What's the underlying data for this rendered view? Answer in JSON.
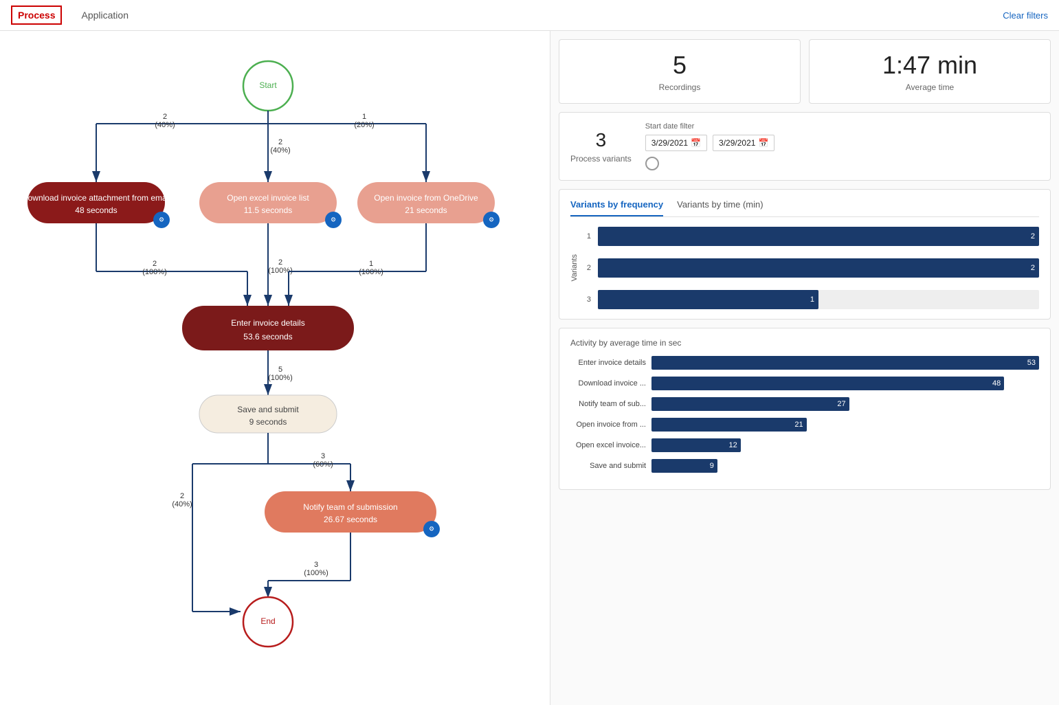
{
  "nav": {
    "tabs": [
      {
        "id": "process",
        "label": "Process",
        "active": true
      },
      {
        "id": "application",
        "label": "Application",
        "active": false
      }
    ],
    "clear_filters": "Clear filters"
  },
  "stats": {
    "recordings": {
      "value": "5",
      "label": "Recordings"
    },
    "average_time": {
      "value": "1:47 min",
      "label": "Average time"
    },
    "process_variants": {
      "value": "3",
      "label": "Process variants"
    },
    "start_date_filter": {
      "label": "Start date filter",
      "from": "3/29/2021",
      "to": "3/29/2021"
    }
  },
  "variants_chart": {
    "tab_frequency": "Variants by frequency",
    "tab_time": "Variants by time (min)",
    "y_label": "Variants",
    "bars": [
      {
        "label": "1",
        "value": 2,
        "pct": 100
      },
      {
        "label": "2",
        "value": 2,
        "pct": 100
      },
      {
        "label": "3",
        "value": 1,
        "pct": 50
      }
    ]
  },
  "activity_chart": {
    "title": "Activity by average time in sec",
    "bars": [
      {
        "label": "Enter invoice details",
        "value": 53,
        "pct": 100
      },
      {
        "label": "Download invoice ...",
        "value": 48,
        "pct": 91
      },
      {
        "label": "Notify team of sub...",
        "value": 27,
        "pct": 51
      },
      {
        "label": "Open invoice from ...",
        "value": 21,
        "pct": 40
      },
      {
        "label": "Open excel invoice...",
        "value": 12,
        "pct": 23
      },
      {
        "label": "Save and submit",
        "value": 9,
        "pct": 17
      }
    ]
  },
  "process_nodes": {
    "start_label": "Start",
    "end_label": "End",
    "nodes": [
      {
        "id": "download",
        "line1": "Download invoice attachment from email",
        "line2": "48 seconds",
        "type": "dark-red"
      },
      {
        "id": "openexcel",
        "line1": "Open excel invoice list",
        "line2": "11.5 seconds",
        "type": "salmon"
      },
      {
        "id": "openonedrive",
        "line1": "Open invoice from OneDrive",
        "line2": "21 seconds",
        "type": "salmon"
      },
      {
        "id": "enterinvoice",
        "line1": "Enter invoice details",
        "line2": "53.6 seconds",
        "type": "dark-red2"
      },
      {
        "id": "savesubmit",
        "line1": "Save and submit",
        "line2": "9 seconds",
        "type": "beige"
      },
      {
        "id": "notify",
        "line1": "Notify team of submission",
        "line2": "26.67 seconds",
        "type": "orange"
      }
    ],
    "edges": [
      {
        "from": "start",
        "to": "download",
        "label": "2\n(40%)"
      },
      {
        "from": "start",
        "to": "openexcel",
        "label": "2\n(40%)"
      },
      {
        "from": "start",
        "to": "openonedrive",
        "label": "1\n(20%)"
      },
      {
        "from": "download",
        "to": "enterinvoice",
        "label": "2\n(100%)"
      },
      {
        "from": "openexcel",
        "to": "enterinvoice",
        "label": "2\n(100%)"
      },
      {
        "from": "openonedrive",
        "to": "enterinvoice",
        "label": "1\n(100%)"
      },
      {
        "from": "enterinvoice",
        "to": "savesubmit",
        "label": "5\n(100%)"
      },
      {
        "from": "savesubmit",
        "to": "notify",
        "label": "3\n(60%)"
      },
      {
        "from": "savesubmit",
        "to": "end",
        "label": "2\n(40%)"
      },
      {
        "from": "notify",
        "to": "end",
        "label": "3\n(100%)"
      }
    ]
  }
}
